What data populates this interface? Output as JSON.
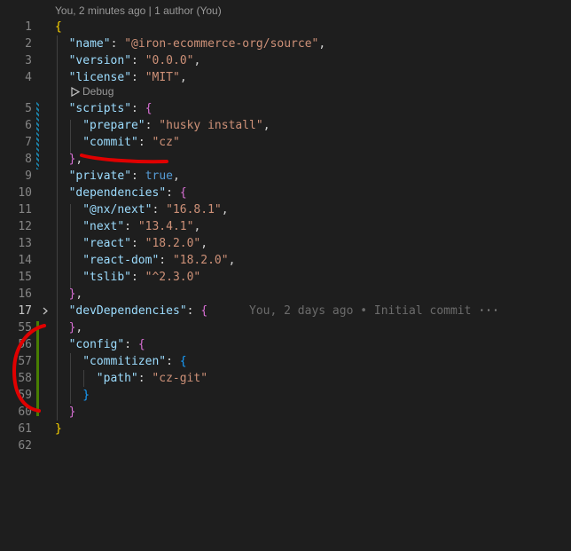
{
  "codelens": {
    "blame_header": "You, 2 minutes ago | 1 author (You)",
    "debug_label": "Debug"
  },
  "lines": [
    {
      "n": "1",
      "tokens": [
        [
          "b1",
          "{"
        ]
      ]
    },
    {
      "n": "2",
      "tokens": [
        [
          "k",
          "\"name\""
        ],
        [
          "p",
          ": "
        ],
        [
          "s",
          "\"@iron-ecommerce-org/source\""
        ],
        [
          "p",
          ","
        ]
      ]
    },
    {
      "n": "3",
      "tokens": [
        [
          "k",
          "\"version\""
        ],
        [
          "p",
          ": "
        ],
        [
          "s",
          "\"0.0.0\""
        ],
        [
          "p",
          ","
        ]
      ]
    },
    {
      "n": "4",
      "tokens": [
        [
          "k",
          "\"license\""
        ],
        [
          "p",
          ": "
        ],
        [
          "s",
          "\"MIT\""
        ],
        [
          "p",
          ","
        ]
      ]
    },
    {
      "n": "5",
      "tokens": [
        [
          "k",
          "\"scripts\""
        ],
        [
          "p",
          ": "
        ],
        [
          "b2",
          "{"
        ]
      ]
    },
    {
      "n": "6",
      "tokens": [
        [
          "k",
          "\"prepare\""
        ],
        [
          "p",
          ": "
        ],
        [
          "s",
          "\"husky install\""
        ],
        [
          "p",
          ","
        ]
      ]
    },
    {
      "n": "7",
      "tokens": [
        [
          "k",
          "\"commit\""
        ],
        [
          "p",
          ": "
        ],
        [
          "s",
          "\"cz\""
        ]
      ]
    },
    {
      "n": "8",
      "tokens": [
        [
          "b2",
          "}"
        ],
        [
          "p",
          ","
        ]
      ]
    },
    {
      "n": "9",
      "tokens": [
        [
          "k",
          "\"private\""
        ],
        [
          "p",
          ": "
        ],
        [
          "kw",
          "true"
        ],
        [
          "p",
          ","
        ]
      ]
    },
    {
      "n": "10",
      "tokens": [
        [
          "k",
          "\"dependencies\""
        ],
        [
          "p",
          ": "
        ],
        [
          "b2",
          "{"
        ]
      ]
    },
    {
      "n": "11",
      "tokens": [
        [
          "k",
          "\"@nx/next\""
        ],
        [
          "p",
          ": "
        ],
        [
          "s",
          "\"16.8.1\""
        ],
        [
          "p",
          ","
        ]
      ]
    },
    {
      "n": "12",
      "tokens": [
        [
          "k",
          "\"next\""
        ],
        [
          "p",
          ": "
        ],
        [
          "s",
          "\"13.4.1\""
        ],
        [
          "p",
          ","
        ]
      ]
    },
    {
      "n": "13",
      "tokens": [
        [
          "k",
          "\"react\""
        ],
        [
          "p",
          ": "
        ],
        [
          "s",
          "\"18.2.0\""
        ],
        [
          "p",
          ","
        ]
      ]
    },
    {
      "n": "14",
      "tokens": [
        [
          "k",
          "\"react-dom\""
        ],
        [
          "p",
          ": "
        ],
        [
          "s",
          "\"18.2.0\""
        ],
        [
          "p",
          ","
        ]
      ]
    },
    {
      "n": "15",
      "tokens": [
        [
          "k",
          "\"tslib\""
        ],
        [
          "p",
          ": "
        ],
        [
          "s",
          "\"^2.3.0\""
        ]
      ]
    },
    {
      "n": "16",
      "tokens": [
        [
          "b2",
          "}"
        ],
        [
          "p",
          ","
        ]
      ]
    },
    {
      "n": "17",
      "tokens": [
        [
          "k",
          "\"devDependencies\""
        ],
        [
          "p",
          ": "
        ],
        [
          "b2",
          "{"
        ]
      ],
      "ghost": "You, 2 days ago • Initial commit",
      "ellipsis": "···"
    },
    {
      "n": "55",
      "tokens": [
        [
          "b2",
          "}"
        ],
        [
          "p",
          ","
        ]
      ]
    },
    {
      "n": "56",
      "tokens": [
        [
          "k",
          "\"config\""
        ],
        [
          "p",
          ": "
        ],
        [
          "b2",
          "{"
        ]
      ]
    },
    {
      "n": "57",
      "tokens": [
        [
          "k",
          "\"commitizen\""
        ],
        [
          "p",
          ": "
        ],
        [
          "b3",
          "{"
        ]
      ]
    },
    {
      "n": "58",
      "tokens": [
        [
          "k",
          "\"path\""
        ],
        [
          "p",
          ": "
        ],
        [
          "s",
          "\"cz-git\""
        ]
      ]
    },
    {
      "n": "59",
      "tokens": [
        [
          "b3",
          "}"
        ]
      ]
    },
    {
      "n": "60",
      "tokens": [
        [
          "b2",
          "}"
        ]
      ]
    },
    {
      "n": "61",
      "tokens": [
        [
          "b1",
          "}"
        ]
      ]
    },
    {
      "n": "62",
      "tokens": []
    }
  ],
  "active_line": "17",
  "colors": {
    "background": "#1e1e1e",
    "key": "#9cdcfe",
    "string": "#ce9178",
    "keyword": "#569cd6",
    "annotation": "#e00000",
    "modified_gutter": "#1b81a8",
    "added_gutter": "#487e02"
  },
  "icons": {
    "debug": "play-outline-icon",
    "fold": "chevron-right-icon"
  }
}
